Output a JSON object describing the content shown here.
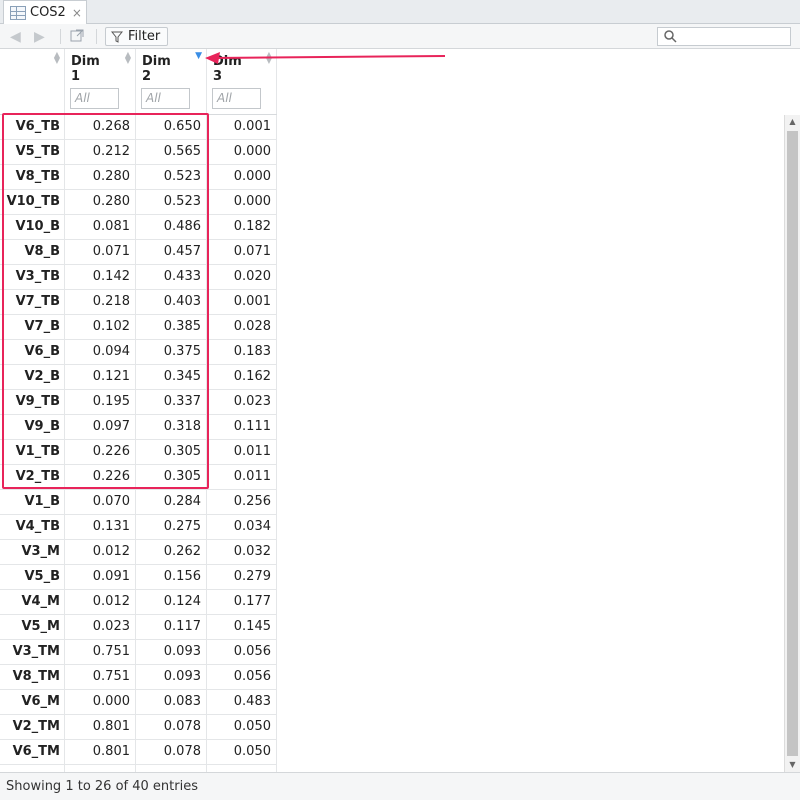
{
  "tab": {
    "title": "COS2",
    "close": "×"
  },
  "toolbar": {
    "filter_label": "Filter"
  },
  "columns": [
    {
      "label": "",
      "filter_placeholder": ""
    },
    {
      "label_line1": "Dim",
      "label_line2": "1",
      "filter_placeholder": "All"
    },
    {
      "label_line1": "Dim",
      "label_line2": "2",
      "filter_placeholder": "All"
    },
    {
      "label_line1": "Dim",
      "label_line2": "3",
      "filter_placeholder": "All"
    }
  ],
  "sort": {
    "column": "Dim 2",
    "direction": "descending"
  },
  "rows": [
    [
      "V6_TB",
      "0.268",
      "0.650",
      "0.001"
    ],
    [
      "V5_TB",
      "0.212",
      "0.565",
      "0.000"
    ],
    [
      "V8_TB",
      "0.280",
      "0.523",
      "0.000"
    ],
    [
      "V10_TB",
      "0.280",
      "0.523",
      "0.000"
    ],
    [
      "V10_B",
      "0.081",
      "0.486",
      "0.182"
    ],
    [
      "V8_B",
      "0.071",
      "0.457",
      "0.071"
    ],
    [
      "V3_TB",
      "0.142",
      "0.433",
      "0.020"
    ],
    [
      "V7_TB",
      "0.218",
      "0.403",
      "0.001"
    ],
    [
      "V7_B",
      "0.102",
      "0.385",
      "0.028"
    ],
    [
      "V6_B",
      "0.094",
      "0.375",
      "0.183"
    ],
    [
      "V2_B",
      "0.121",
      "0.345",
      "0.162"
    ],
    [
      "V9_TB",
      "0.195",
      "0.337",
      "0.023"
    ],
    [
      "V9_B",
      "0.097",
      "0.318",
      "0.111"
    ],
    [
      "V1_TB",
      "0.226",
      "0.305",
      "0.011"
    ],
    [
      "V2_TB",
      "0.226",
      "0.305",
      "0.011"
    ],
    [
      "V1_B",
      "0.070",
      "0.284",
      "0.256"
    ],
    [
      "V4_TB",
      "0.131",
      "0.275",
      "0.034"
    ],
    [
      "V3_M",
      "0.012",
      "0.262",
      "0.032"
    ],
    [
      "V5_B",
      "0.091",
      "0.156",
      "0.279"
    ],
    [
      "V4_M",
      "0.012",
      "0.124",
      "0.177"
    ],
    [
      "V5_M",
      "0.023",
      "0.117",
      "0.145"
    ],
    [
      "V3_TM",
      "0.751",
      "0.093",
      "0.056"
    ],
    [
      "V8_TM",
      "0.751",
      "0.093",
      "0.056"
    ],
    [
      "V6_M",
      "0.000",
      "0.083",
      "0.483"
    ],
    [
      "V2_TM",
      "0.801",
      "0.078",
      "0.050"
    ],
    [
      "V6_TM",
      "0.801",
      "0.078",
      "0.050"
    ],
    [
      "",
      "",
      "",
      ""
    ]
  ],
  "footer": {
    "status": "Showing 1 to 26 of 40 entries"
  },
  "colors": {
    "highlight": "#e8245a",
    "sort_active": "#3a8ee6"
  }
}
